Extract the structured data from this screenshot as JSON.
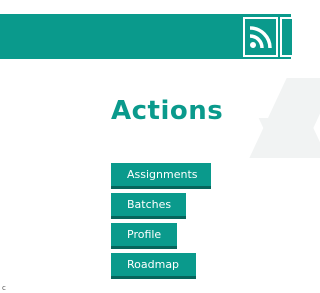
{
  "header": {
    "rss_icon": "rss-icon",
    "accent_color": "#0a9a8c"
  },
  "main": {
    "title": "Actions",
    "actions": [
      {
        "label": "Assignments"
      },
      {
        "label": "Batches"
      },
      {
        "label": "Profile"
      },
      {
        "label": "Roadmap"
      }
    ]
  },
  "footer": {
    "mark": "c"
  }
}
